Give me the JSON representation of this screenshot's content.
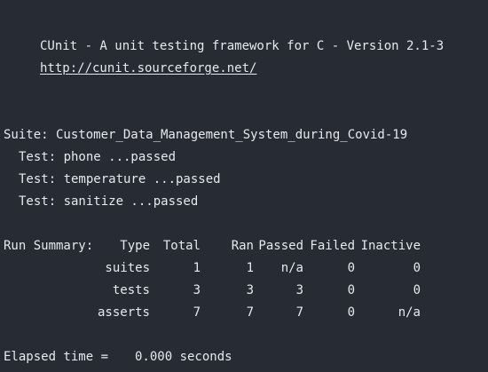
{
  "header": {
    "title": "CUnit - A unit testing framework for C - Version 2.1-3",
    "url": "http://cunit.sourceforge.net/"
  },
  "suite": {
    "line": "Suite: Customer_Data_Management_System_during_Covid-19",
    "tests": [
      "Test: phone ...passed",
      "Test: temperature ...passed",
      "Test: sanitize ...passed"
    ]
  },
  "summary": {
    "label": "Run Summary:",
    "columns": [
      "Type",
      "Total",
      "Ran",
      "Passed",
      "Failed",
      "Inactive"
    ],
    "rows": [
      {
        "type": "suites",
        "total": "1",
        "ran": "1",
        "passed": "n/a",
        "failed": "0",
        "inactive": "0"
      },
      {
        "type": "tests",
        "total": "3",
        "ran": "3",
        "passed": "3",
        "failed": "0",
        "inactive": "0"
      },
      {
        "type": "asserts",
        "total": "7",
        "ran": "7",
        "passed": "7",
        "failed": "0",
        "inactive": "n/a"
      }
    ]
  },
  "elapsed": {
    "label": "Elapsed time =",
    "value": "0.000 seconds"
  },
  "colors": {
    "background": "#272b33",
    "text": "#e6e9ef"
  }
}
